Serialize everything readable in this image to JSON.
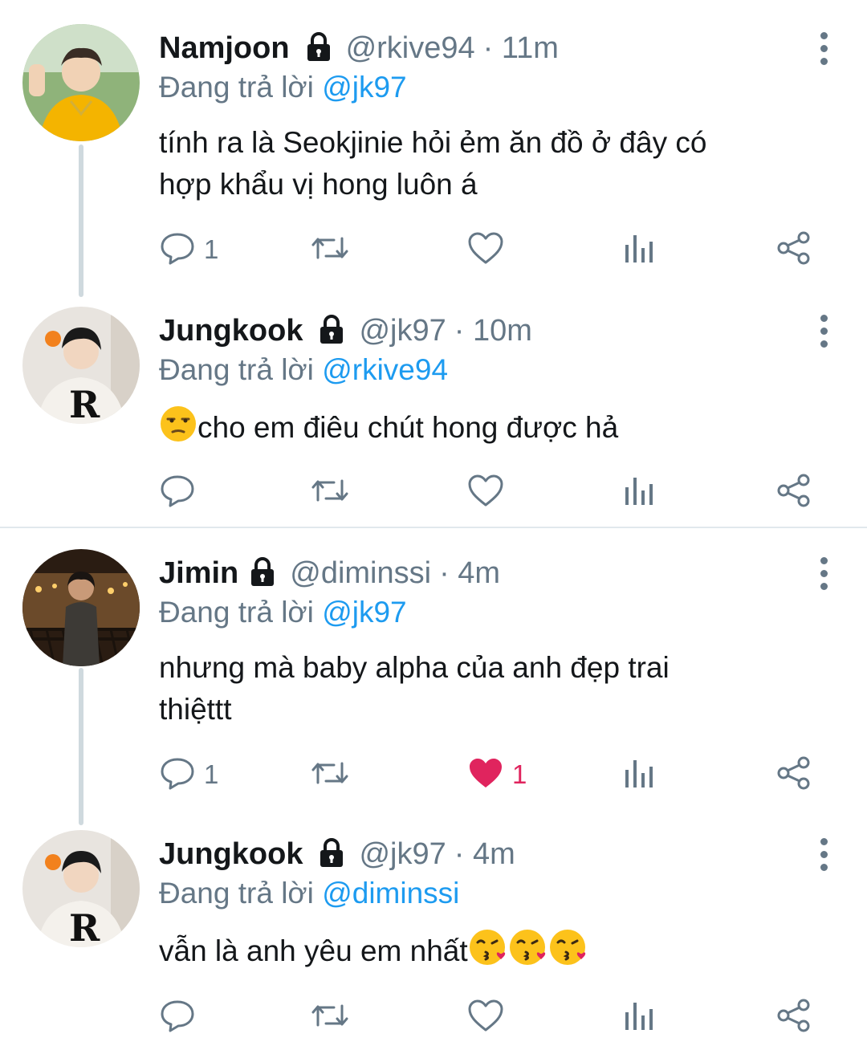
{
  "replies_to_prefix": "Đang trả lời",
  "icons": {
    "reply": "reply-icon",
    "retweet": "retweet-icon",
    "like": "heart-icon",
    "analytics": "analytics-icon",
    "share": "share-icon",
    "lock": "lock-icon",
    "more": "more-vertical-icon"
  },
  "colors": {
    "mention": "#1d9bf0",
    "muted": "#657786",
    "liked": "#e0245e"
  },
  "tweets": [
    {
      "name": "Namjoon",
      "handle": "@rkive94",
      "time": "· 11m",
      "reply_to": "@jk97",
      "text_line1": "tính ra là Seokjinie hỏi ẻm ăn đồ ở đây có",
      "text_line2": "hợp khẩu vị hong luôn á",
      "reply_count": "1",
      "like_count": "",
      "liked": false
    },
    {
      "name": "Jungkook",
      "handle": "@jk97",
      "time": "· 10m",
      "reply_to": "@rkive94",
      "text_line1": "cho em điêu chút hong được hả",
      "reply_count": "",
      "like_count": "",
      "liked": false
    },
    {
      "name": "Jimin",
      "handle": "@diminssi",
      "time": "· 4m",
      "reply_to": "@jk97",
      "text_line1": "nhưng mà baby alpha của anh đẹp trai",
      "text_line2": "thiệttt",
      "reply_count": "1",
      "like_count": "1",
      "liked": true
    },
    {
      "name": "Jungkook",
      "handle": "@jk97",
      "time": "· 4m",
      "reply_to": "@diminssi",
      "text_line1": "vẫn là anh yêu em nhất",
      "reply_count": "",
      "like_count": "",
      "liked": false
    }
  ]
}
